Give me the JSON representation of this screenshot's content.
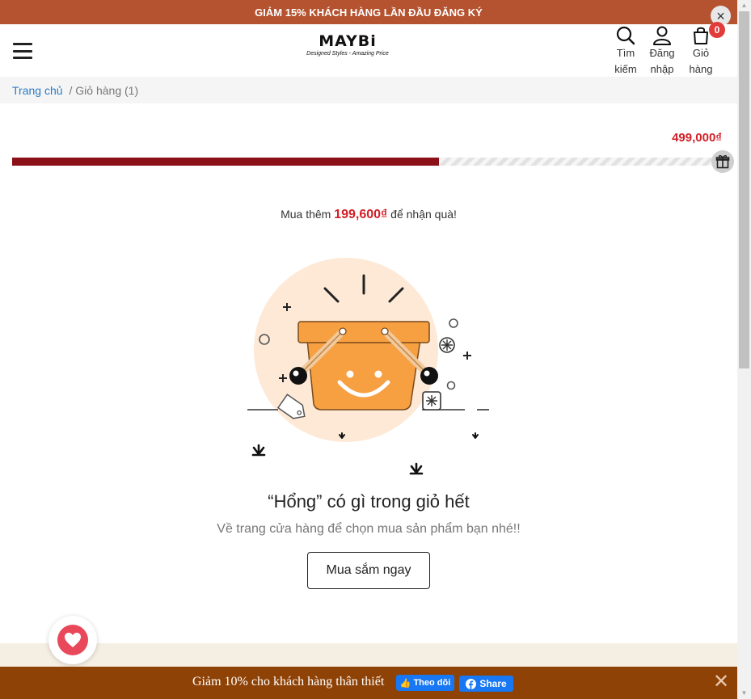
{
  "announcement": {
    "text": "GIẢM 15% KHÁCH HÀNG LẦN ĐẦU ĐĂNG KÝ"
  },
  "header": {
    "logo_name": "MAYBi",
    "logo_tagline": "Designed Styles - Amazing Price",
    "actions": {
      "search": {
        "line1": "Tìm",
        "line2": "kiếm",
        "icon": "search-icon"
      },
      "login": {
        "line1": "Đăng",
        "line2": "nhập",
        "icon": "user-icon"
      },
      "cart": {
        "line1": "Giỏ",
        "line2": "hàng",
        "icon": "bag-icon",
        "count": "0"
      }
    }
  },
  "breadcrumb": {
    "home": "Trang chủ",
    "current": "/ Giỏ hàng (1)"
  },
  "gift_progress": {
    "threshold": "499,000₫",
    "progress": 0.6,
    "message_before": "Mua thêm ",
    "amount_needed": "199,600₫",
    "message_after": " để nhận quà!",
    "colors": {
      "fill": "#8b1018",
      "price": "#d21f27"
    }
  },
  "empty_cart": {
    "title": "“Hổng” có gì trong giỏ hết",
    "subtitle": "Về trang cửa hàng để chọn mua sản phẩm bạn nhé!!",
    "button_label": "Mua sắm ngay",
    "illustration": "smiling-basket-illustration"
  },
  "promo_bar": {
    "text": "Giảm 10% cho khách hàng thân thiết",
    "follow_label": "Theo dõi",
    "share_label": "Share",
    "background": "#8f4206"
  },
  "colors": {
    "announcement_bg": "#b5522f",
    "link": "#2a7ac7",
    "wishlist": "#e8485a"
  }
}
